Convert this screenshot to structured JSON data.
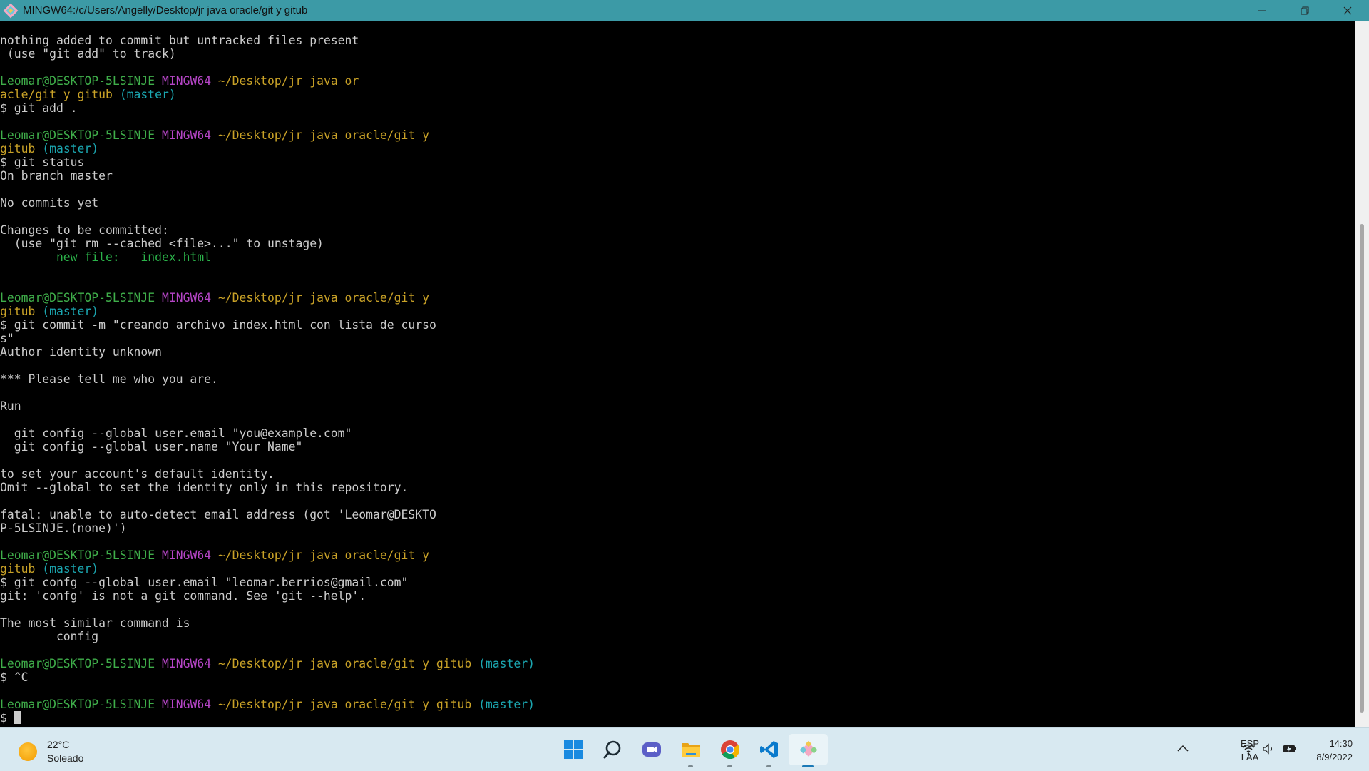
{
  "window": {
    "title": "MINGW64:/c/Users/Angelly/Desktop/jr java oracle/git y gitub",
    "minimize_icon": "minimize-icon",
    "maximize_icon": "restore-icon",
    "close_icon": "close-icon"
  },
  "terminal": {
    "lines": [
      [
        {
          "t": "nothing added to commit but untracked files present"
        }
      ],
      [
        {
          "t": " (use \"git add\" to track)"
        }
      ],
      [],
      [
        {
          "t": "Leomar@DESKTOP-5LSINJE",
          "c": "user"
        },
        {
          "t": " "
        },
        {
          "t": "MINGW64",
          "c": "host"
        },
        {
          "t": " "
        },
        {
          "t": "~/Desktop/jr java or",
          "c": "path"
        }
      ],
      [
        {
          "t": "acle/git y gitub",
          "c": "path"
        },
        {
          "t": " "
        },
        {
          "t": "(master)",
          "c": "branch"
        }
      ],
      [
        {
          "t": "$ git add ."
        }
      ],
      [],
      [
        {
          "t": "Leomar@DESKTOP-5LSINJE",
          "c": "user"
        },
        {
          "t": " "
        },
        {
          "t": "MINGW64",
          "c": "host"
        },
        {
          "t": " "
        },
        {
          "t": "~/Desktop/jr java oracle/git y",
          "c": "path"
        }
      ],
      [
        {
          "t": "gitub",
          "c": "path"
        },
        {
          "t": " "
        },
        {
          "t": "(master)",
          "c": "branch"
        }
      ],
      [
        {
          "t": "$ git status"
        }
      ],
      [
        {
          "t": "On branch master"
        }
      ],
      [],
      [
        {
          "t": "No commits yet"
        }
      ],
      [],
      [
        {
          "t": "Changes to be committed:"
        }
      ],
      [
        {
          "t": "  (use \"git rm --cached <file>...\" to unstage)"
        }
      ],
      [
        {
          "t": "        new file:   index.html",
          "c": "green"
        }
      ],
      [],
      [],
      [
        {
          "t": "Leomar@DESKTOP-5LSINJE",
          "c": "user"
        },
        {
          "t": " "
        },
        {
          "t": "MINGW64",
          "c": "host"
        },
        {
          "t": " "
        },
        {
          "t": "~/Desktop/jr java oracle/git y",
          "c": "path"
        }
      ],
      [
        {
          "t": "gitub",
          "c": "path"
        },
        {
          "t": " "
        },
        {
          "t": "(master)",
          "c": "branch"
        }
      ],
      [
        {
          "t": "$ git commit -m \"creando archivo index.html con lista de curso"
        }
      ],
      [
        {
          "t": "s\""
        }
      ],
      [
        {
          "t": "Author identity unknown"
        }
      ],
      [],
      [
        {
          "t": "*** Please tell me who you are."
        }
      ],
      [],
      [
        {
          "t": "Run"
        }
      ],
      [],
      [
        {
          "t": "  git config --global user.email \"you@example.com\""
        }
      ],
      [
        {
          "t": "  git config --global user.name \"Your Name\""
        }
      ],
      [],
      [
        {
          "t": "to set your account's default identity."
        }
      ],
      [
        {
          "t": "Omit --global to set the identity only in this repository."
        }
      ],
      [],
      [
        {
          "t": "fatal: unable to auto-detect email address (got 'Leomar@DESKTO"
        }
      ],
      [
        {
          "t": "P-5LSINJE.(none)')"
        }
      ],
      [],
      [
        {
          "t": "Leomar@DESKTOP-5LSINJE",
          "c": "user"
        },
        {
          "t": " "
        },
        {
          "t": "MINGW64",
          "c": "host"
        },
        {
          "t": " "
        },
        {
          "t": "~/Desktop/jr java oracle/git y",
          "c": "path"
        }
      ],
      [
        {
          "t": "gitub",
          "c": "path"
        },
        {
          "t": " "
        },
        {
          "t": "(master)",
          "c": "branch"
        }
      ],
      [
        {
          "t": "$ git confg --global user.email \"leomar.berrios@gmail.com\""
        }
      ],
      [
        {
          "t": "git: 'confg' is not a git command. See 'git --help'."
        }
      ],
      [],
      [
        {
          "t": "The most similar command is"
        }
      ],
      [
        {
          "t": "        config"
        }
      ],
      [],
      [
        {
          "t": "Leomar@DESKTOP-5LSINJE",
          "c": "user"
        },
        {
          "t": " "
        },
        {
          "t": "MINGW64",
          "c": "host"
        },
        {
          "t": " "
        },
        {
          "t": "~/Desktop/jr java oracle/git y gitub",
          "c": "path"
        },
        {
          "t": " "
        },
        {
          "t": "(master)",
          "c": "branch"
        }
      ],
      [
        {
          "t": "$ ^C"
        }
      ],
      [],
      [
        {
          "t": "Leomar@DESKTOP-5LSINJE",
          "c": "user"
        },
        {
          "t": " "
        },
        {
          "t": "MINGW64",
          "c": "host"
        },
        {
          "t": " "
        },
        {
          "t": "~/Desktop/jr java oracle/git y gitub",
          "c": "path"
        },
        {
          "t": " "
        },
        {
          "t": "(master)",
          "c": "branch"
        }
      ],
      [
        {
          "t": "$ "
        },
        {
          "cursor": true
        }
      ]
    ]
  },
  "colors": {
    "user": "#3fae4a",
    "host": "#b545c6",
    "path": "#c9a227",
    "branch": "#1ba6b0",
    "green": "#2bb34a"
  },
  "taskbar": {
    "weather": {
      "temp": "22°C",
      "condition": "Soleado",
      "icon": "sun-icon"
    },
    "apps": [
      {
        "name": "start-button",
        "icon": "windows-icon",
        "active": false,
        "running": false
      },
      {
        "name": "search-button",
        "icon": "search-icon",
        "active": false,
        "running": false
      },
      {
        "name": "teams-chat-button",
        "icon": "chat-icon",
        "active": false,
        "running": false
      },
      {
        "name": "file-explorer-button",
        "icon": "folder-icon",
        "active": false,
        "running": true
      },
      {
        "name": "chrome-button",
        "icon": "chrome-icon",
        "active": false,
        "running": true
      },
      {
        "name": "vscode-button",
        "icon": "vscode-icon",
        "active": false,
        "running": true
      },
      {
        "name": "git-bash-button",
        "icon": "git-icon",
        "active": true,
        "running": true
      }
    ],
    "tray": {
      "lang_top": "ESP",
      "lang_bottom": "LAA",
      "time": "14:30",
      "date": "8/9/2022"
    }
  }
}
